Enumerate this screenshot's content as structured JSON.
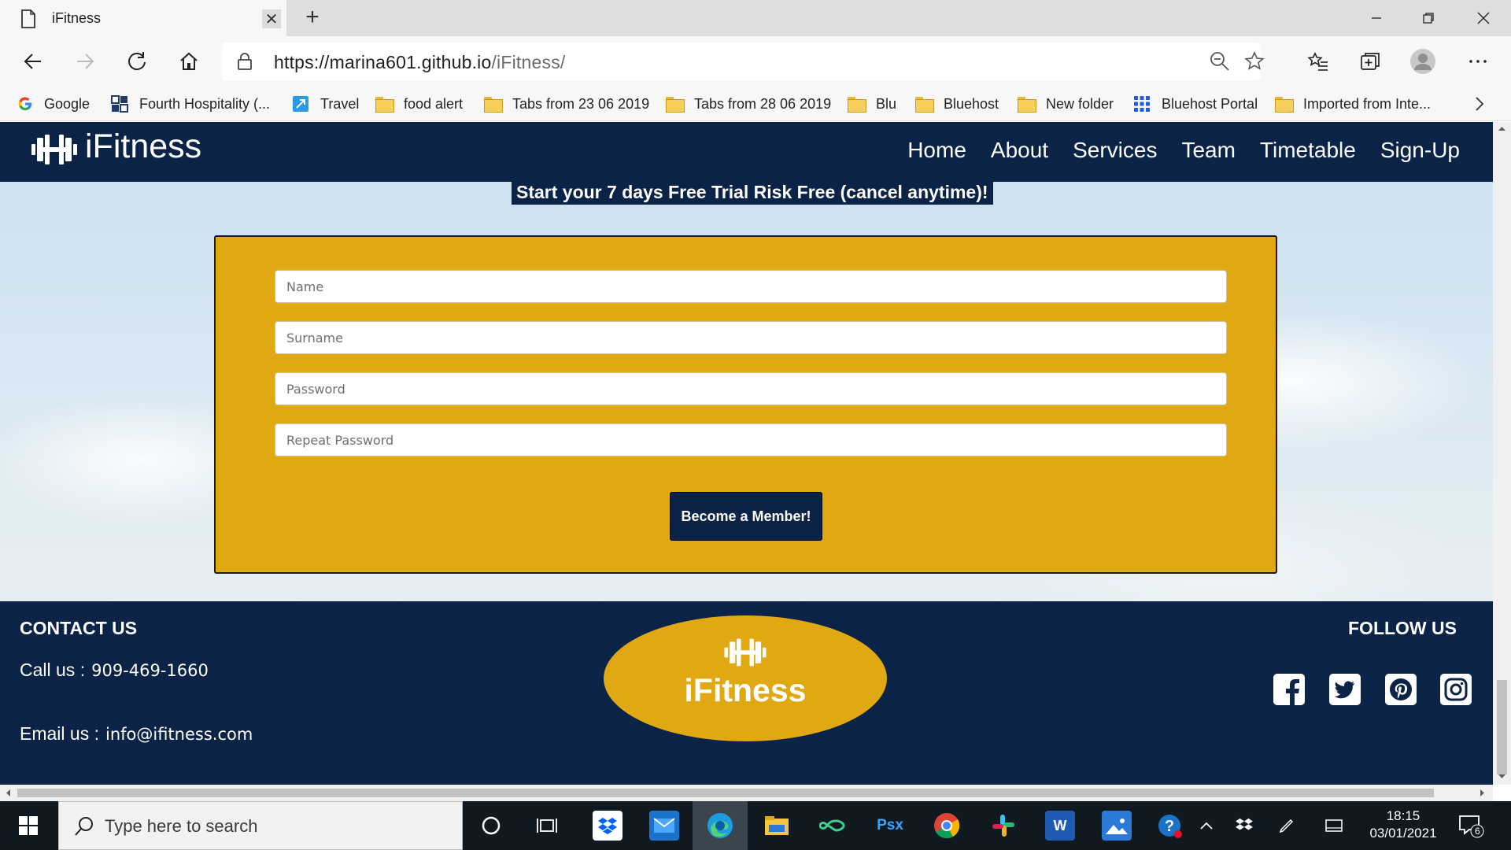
{
  "browser": {
    "tab_title": "iFitness",
    "tab_close": "✕",
    "new_tab": "+",
    "url_main": "https://marina601.github.io",
    "url_path": "/iFitness/"
  },
  "bookmarks": [
    {
      "label": "Google",
      "icon": "google-icon"
    },
    {
      "label": "Fourth Hospitality (...",
      "icon": "fourth-icon"
    },
    {
      "label": "Travel",
      "icon": "travel-icon"
    },
    {
      "label": "food alert",
      "icon": "folder-icon"
    },
    {
      "label": "Tabs from 23 06 2019",
      "icon": "folder-icon"
    },
    {
      "label": "Tabs from 28 06 2019",
      "icon": "folder-icon"
    },
    {
      "label": "Blu",
      "icon": "folder-icon"
    },
    {
      "label": "Bluehost",
      "icon": "folder-icon"
    },
    {
      "label": "New folder",
      "icon": "folder-icon"
    },
    {
      "label": "Bluehost Portal",
      "icon": "grid-icon"
    },
    {
      "label": "Imported from Inte...",
      "icon": "folder-icon"
    }
  ],
  "site": {
    "logo_text": "iFitness",
    "nav": [
      "Home",
      "About",
      "Services",
      "Team",
      "Timetable",
      "Sign-Up"
    ],
    "trial_banner": "Start your 7 days Free Trial Risk Free (cancel anytime)!",
    "form": {
      "name_placeholder": "Name",
      "surname_placeholder": "Surname",
      "password_placeholder": "Password",
      "repeat_password_placeholder": "Repeat Password",
      "submit_label": "Become a Member!"
    },
    "footer": {
      "contact_heading": "CONTACT US",
      "call_label": "Call us :",
      "call_value": "909-469-1660",
      "email_label": "Email us :",
      "email_value": "info@ifitness.com",
      "logo_text": "iFitness",
      "follow_heading": "FOLLOW US",
      "social": [
        "facebook-icon",
        "twitter-icon",
        "pinterest-icon",
        "instagram-icon"
      ]
    },
    "colors": {
      "navy": "#0a2347",
      "gold": "#e0a813"
    }
  },
  "taskbar": {
    "search_placeholder": "Type here to search",
    "time": "18:15",
    "date": "03/01/2021",
    "notifications": "6"
  }
}
